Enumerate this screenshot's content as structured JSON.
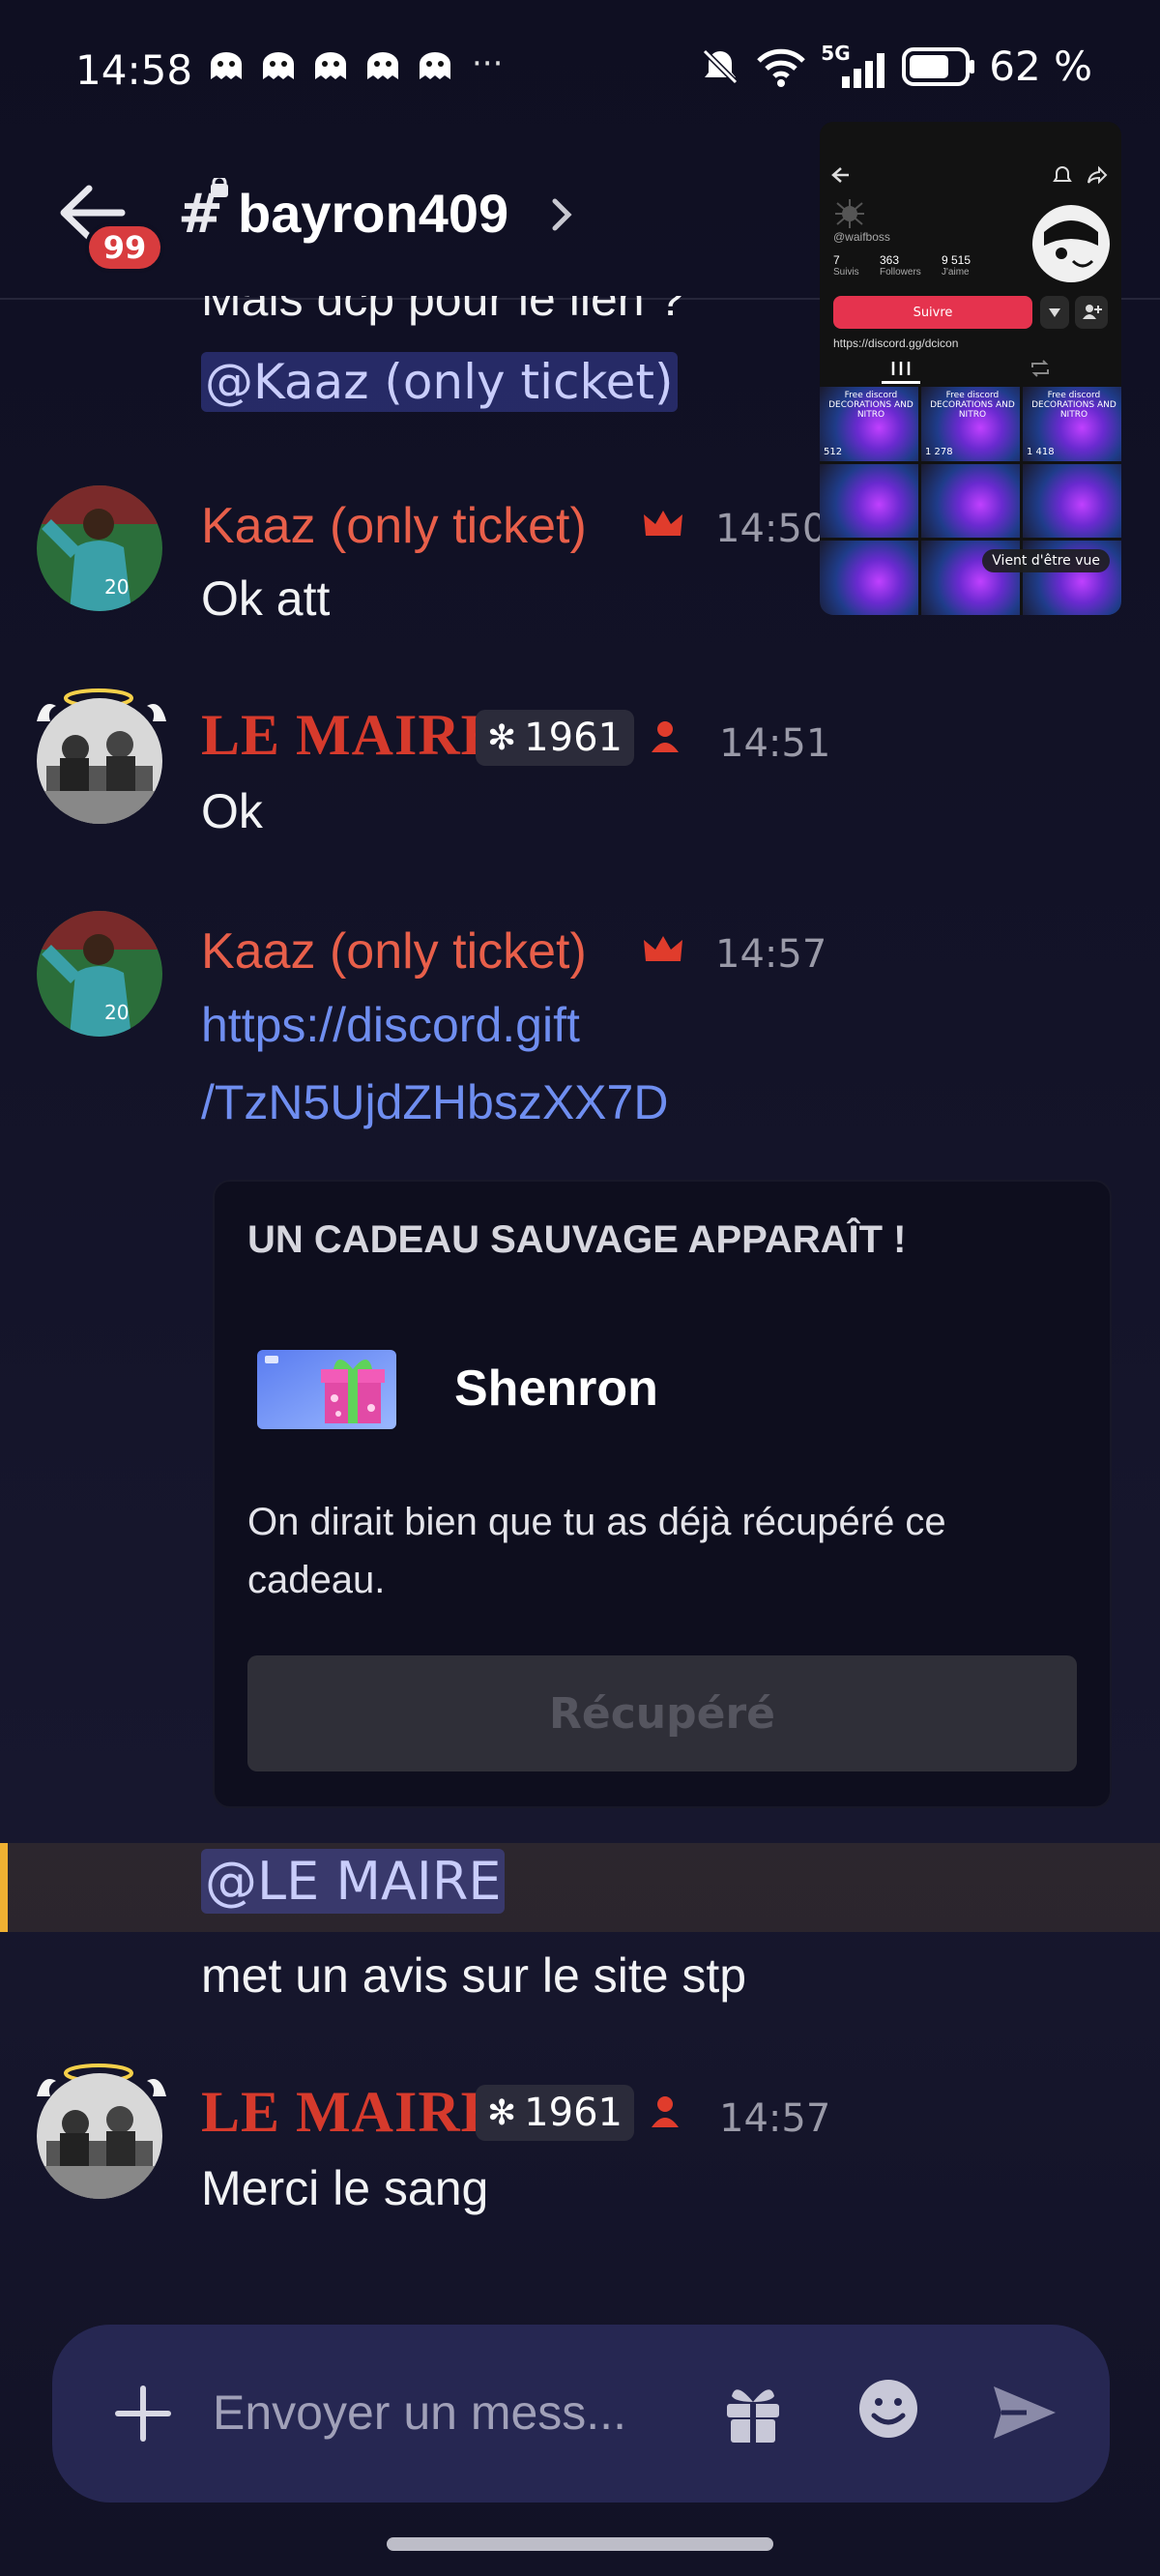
{
  "status_bar": {
    "time": "14:58",
    "dots": "···",
    "network": "5G",
    "battery": "62 %"
  },
  "header": {
    "unread_badge": "99",
    "channel_name": "bayron409"
  },
  "messages": {
    "cut_text": "Mais dcp pour le lien ?",
    "cut_mention": "@Kaaz (only ticket)",
    "m1": {
      "author": "Kaaz (only ticket)",
      "time": "14:50",
      "text": "Ok att"
    },
    "m2": {
      "author": "LE MAIRE",
      "tag": "1961",
      "time": "14:51",
      "text": "Ok"
    },
    "m3": {
      "author": "Kaaz (only ticket)",
      "time": "14:57",
      "link_line1": "https://discord.gift",
      "link_line2": "/TzN5UjdZHbszXX7D"
    },
    "gift": {
      "heading": "UN CADEAU SAUVAGE APPARAÎT !",
      "name": "Shenron",
      "description": "On dirait bien que tu as déjà récupéré ce cadeau.",
      "button": "Récupéré"
    },
    "m4": {
      "mention": "@LE MAIRE",
      "text": "met un avis sur le site stp"
    },
    "m5": {
      "author": "LE MAIRE",
      "tag": "1961",
      "time": "14:57",
      "text": "Merci le sang"
    }
  },
  "composer": {
    "placeholder": "Envoyer un mess..."
  },
  "pip": {
    "handle": "@waifboss",
    "stats": [
      {
        "value": "7",
        "label": "Suivis"
      },
      {
        "value": "363",
        "label": "Followers"
      },
      {
        "value": "9 515",
        "label": "J'aime"
      }
    ],
    "follow_button": "Suivre",
    "link": "https://discord.gg/dcicon",
    "tile_title": "Free discord DECORATIONS AND NITRO",
    "tile_counts": [
      "512",
      "1 278",
      "1 418"
    ],
    "pill": "Vient d'être vue"
  },
  "colors": {
    "accent_link": "#6f8ef0",
    "author_kaaz": "#e85f4a",
    "author_maire": "#d63a2c",
    "badge_red": "#d83c3e",
    "mention_bar": "#f0b132"
  }
}
